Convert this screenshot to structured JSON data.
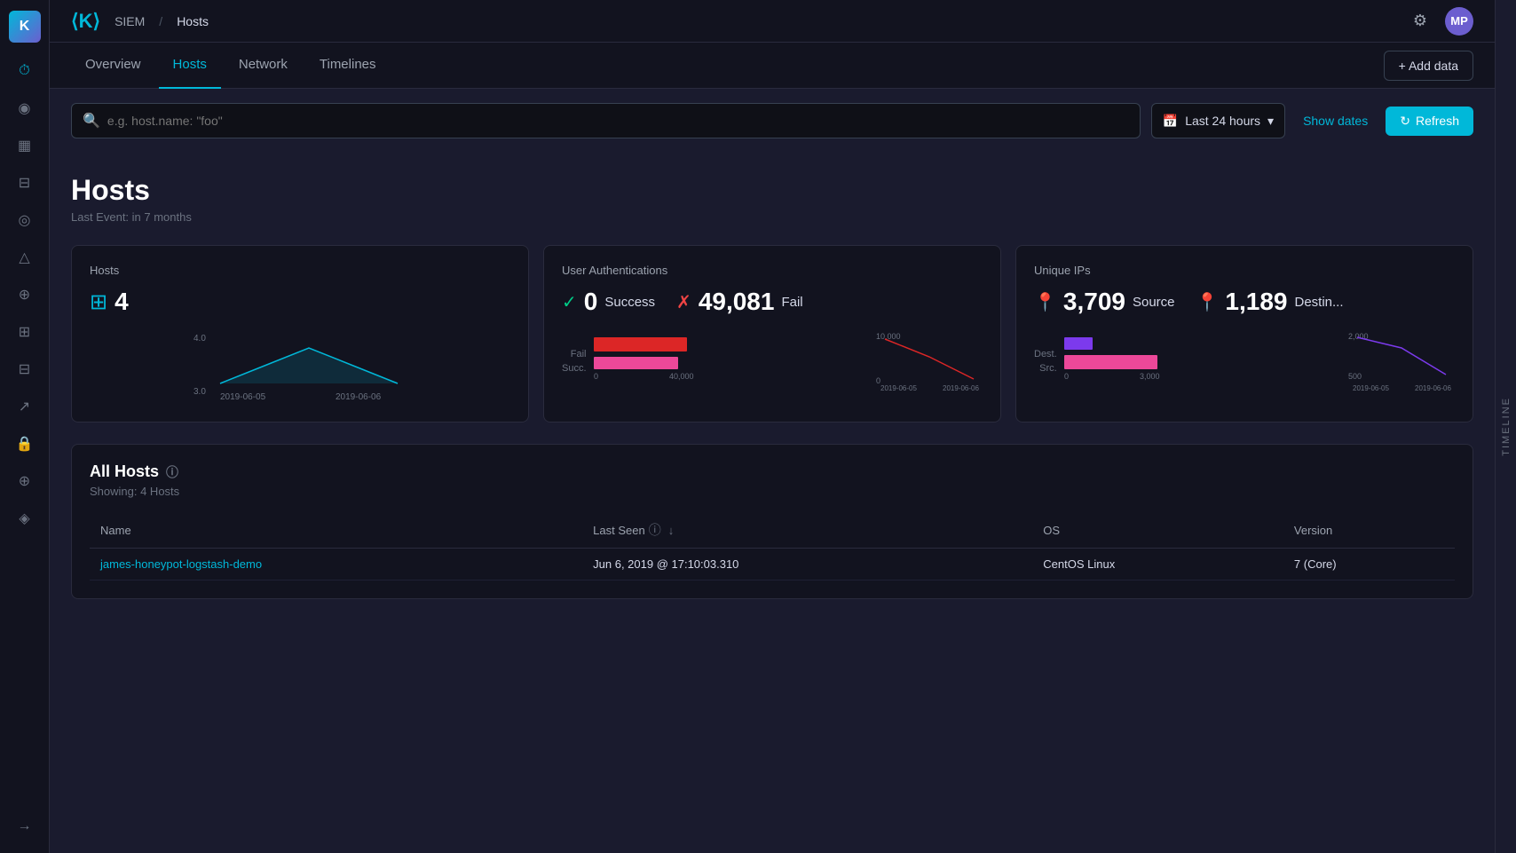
{
  "app": {
    "logo_letter": "K",
    "breadcrumb_siem": "SIEM",
    "breadcrumb_sep": "/",
    "breadcrumb_page": "Hosts",
    "settings_icon": "⚙",
    "user_initials": "MP"
  },
  "tabs": {
    "items": [
      {
        "label": "Overview",
        "active": false
      },
      {
        "label": "Hosts",
        "active": true
      },
      {
        "label": "Network",
        "active": false
      },
      {
        "label": "Timelines",
        "active": false
      }
    ],
    "add_data_label": "+ Add data"
  },
  "search": {
    "placeholder": "e.g. host.name: \"foo\"",
    "time_range": "Last 24 hours",
    "show_dates_label": "Show dates",
    "refresh_label": "Refresh"
  },
  "page": {
    "title": "Hosts",
    "subtitle": "Last Event: in 7 months"
  },
  "stat_cards": [
    {
      "title": "Hosts",
      "metrics": [
        {
          "icon": "grid",
          "value": "4",
          "label": ""
        }
      ],
      "chart_type": "line",
      "y_min": "3.0",
      "y_max": "4.0",
      "x_min": "2019-06-05",
      "x_max": "2019-06-06"
    },
    {
      "title": "User Authentications",
      "metrics": [
        {
          "icon": "check",
          "value": "0",
          "label": "Success"
        },
        {
          "icon": "x",
          "value": "49,081",
          "label": "Fail"
        }
      ],
      "bar_labels": [
        "Fail",
        "Succ."
      ],
      "bar_values": [
        40000,
        38000
      ],
      "x_max": "40,000",
      "x_min": "0",
      "chart_type": "bar",
      "y_min": "0",
      "y_max": "10,000",
      "x_date_min": "2019-06-05",
      "x_date_max": "2019-06-06"
    },
    {
      "title": "Unique IPs",
      "metrics": [
        {
          "icon": "pin",
          "value": "3,709",
          "label": "Source"
        },
        {
          "icon": "pin2",
          "value": "1,189",
          "label": "Destin..."
        }
      ],
      "bar_labels": [
        "Dest.",
        "Src."
      ],
      "bar_values": [
        800,
        3000
      ],
      "x_max": "3,000",
      "x_min": "0",
      "chart_type": "bar",
      "y_max": "2,000",
      "y_min": "500",
      "x_date_min": "2019-06-05",
      "x_date_max": "2019-06-06"
    }
  ],
  "all_hosts": {
    "title": "All Hosts",
    "subtitle": "Showing: 4 Hosts",
    "columns": [
      "Name",
      "Last Seen",
      "OS",
      "Version"
    ],
    "rows": [
      {
        "name": "james-honeypot-logstash-demo",
        "last_seen": "Jun 6, 2019 @ 17:10:03.310",
        "os": "CentOS Linux",
        "version": "7 (Core)"
      }
    ]
  },
  "timeline_sidebar": {
    "label": "TIMELINE"
  },
  "nav_icons": [
    {
      "name": "clock-icon",
      "glyph": "🕐"
    },
    {
      "name": "alerts-icon",
      "glyph": "◉"
    },
    {
      "name": "dashboard-icon",
      "glyph": "▦"
    },
    {
      "name": "cases-icon",
      "glyph": "⊟"
    },
    {
      "name": "investigate-icon",
      "glyph": "◎"
    },
    {
      "name": "rules-icon",
      "glyph": "△"
    },
    {
      "name": "exceptions-icon",
      "glyph": "⊕"
    },
    {
      "name": "trusted-apps-icon",
      "glyph": "⊞"
    },
    {
      "name": "endpoints-icon",
      "glyph": "⊟"
    },
    {
      "name": "fleet-icon",
      "glyph": "↗"
    },
    {
      "name": "lock-icon",
      "glyph": "🔒"
    },
    {
      "name": "integrations-icon",
      "glyph": "⊕"
    },
    {
      "name": "ml-icon",
      "glyph": "◈"
    },
    {
      "name": "arrow-icon",
      "glyph": "→"
    }
  ]
}
